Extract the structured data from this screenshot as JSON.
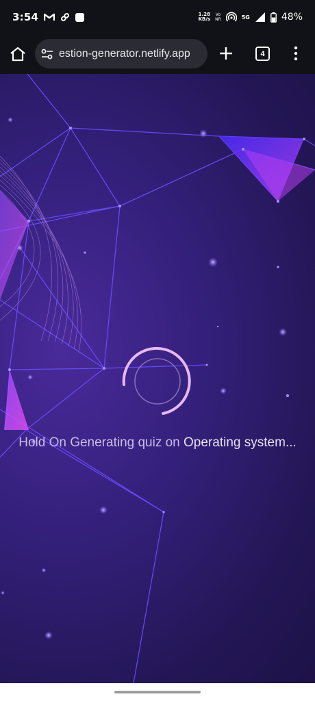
{
  "status_bar": {
    "time": "3:54",
    "speed_value": "1.28",
    "speed_unit": "KB/s",
    "volte_top": "Vo",
    "volte_bottom": "NR",
    "network": "5G",
    "battery": "48%"
  },
  "browser": {
    "url": "estion-generator.netlify.app",
    "tab_count": "4"
  },
  "loader": {
    "prefix": "Hold On Generating quiz on ",
    "subject": "Operating system",
    "suffix": "..."
  },
  "colors": {
    "background_top": "#33207a",
    "background_bottom": "#1d1247",
    "network_lines": "#6a4cff",
    "spinner": "#e7b8f3",
    "accent_pink": "#e24cf0"
  }
}
